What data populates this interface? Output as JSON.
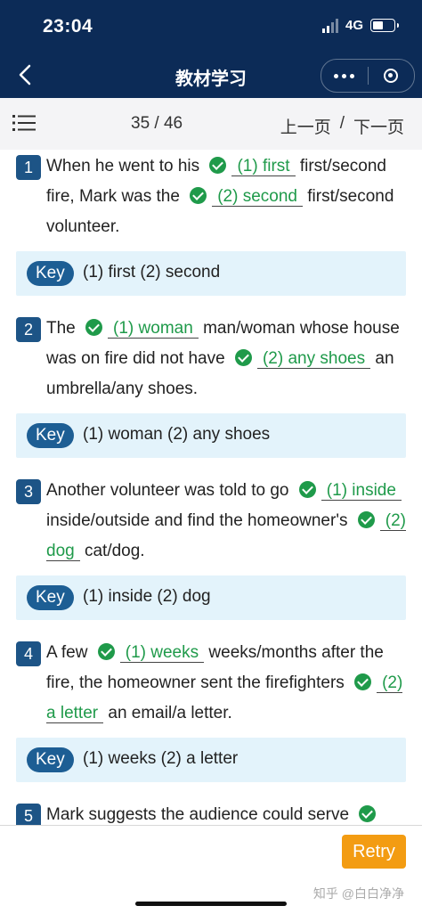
{
  "status": {
    "time": "23:04",
    "network": "4G"
  },
  "nav": {
    "title": "教材学习",
    "back_icon": "back-chevron-icon",
    "more_icon": "more-dots-icon",
    "close_icon": "target-close-icon"
  },
  "toolbar": {
    "page_indicator": "35 / 46",
    "prev_label": "上一页",
    "separator": "/",
    "next_label": "下一页"
  },
  "key_label": "Key",
  "questions": [
    {
      "num": "1",
      "segments": [
        "When he went to his",
        "first/second fire, Mark was the",
        "first/second volunteer."
      ],
      "answers": [
        "(1) first",
        "(2) second"
      ],
      "key": "(1) first  (2) second"
    },
    {
      "num": "2",
      "segments": [
        "The",
        "man/woman whose house was on fire did not have",
        "an umbrella/any shoes."
      ],
      "answers": [
        "(1) woman",
        "(2) any shoes"
      ],
      "key": "(1) woman  (2) any shoes"
    },
    {
      "num": "3",
      "segments": [
        "Another volunteer was told to go",
        "inside/outside and find the homeowner's",
        "cat/dog."
      ],
      "answers": [
        "(1) inside",
        "(2) dog"
      ],
      "key": "(1) inside  (2) dog"
    },
    {
      "num": "4",
      "segments": [
        "A few",
        "weeks/months after the fire, the homeowner sent the firefighters",
        "an email/a letter."
      ],
      "answers": [
        "(1) weeks",
        "(2) a letter"
      ],
      "key": "(1) weeks  (2) a letter"
    },
    {
      "num": "5",
      "segments": [
        "Mark suggests the audience could serve"
      ]
    }
  ],
  "retry_label": "Retry",
  "watermark": "知乎 @白白净净",
  "colors": {
    "header_bg": "#0c2b57",
    "correct": "#1f9a4a",
    "key_bg": "#e3f3fb",
    "key_tag": "#1d5e94",
    "retry": "#f39c12"
  }
}
